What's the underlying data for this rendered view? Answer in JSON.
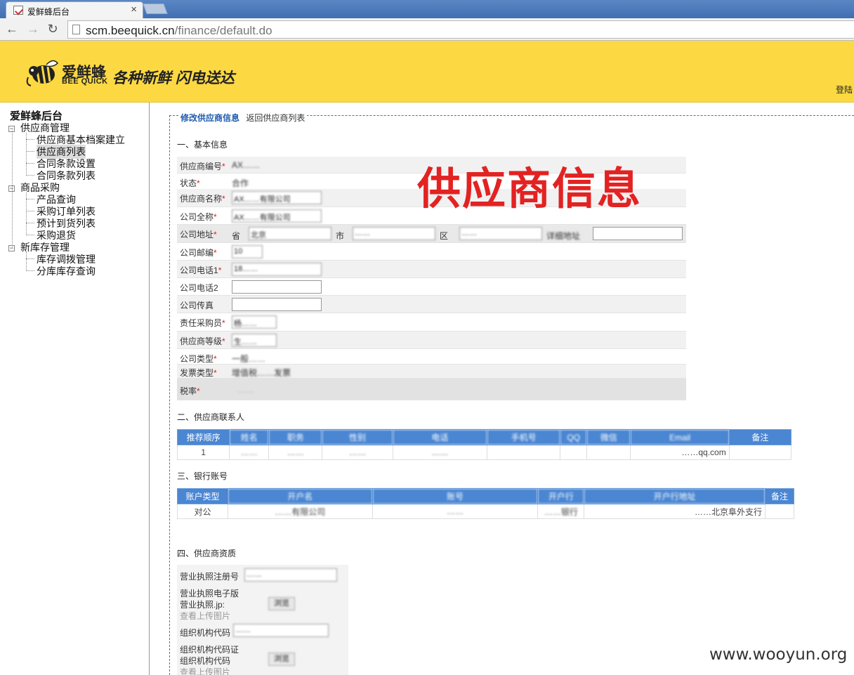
{
  "browser": {
    "tab_title": "爱鲜蜂后台",
    "close_glyph": "×",
    "url_host": "scm.beequick.cn",
    "url_path": "/finance/default.do",
    "back_glyph": "←",
    "forward_glyph": "→",
    "reload_glyph": "↻"
  },
  "header": {
    "logo_name": "爱鲜蜂",
    "logo_en": "BEE QUICK",
    "slogan": "各种新鲜  闪电送达",
    "login": "登陆",
    "bg_color": "#fcd943"
  },
  "sidebar": {
    "title": "爱鲜蜂后台",
    "groups": [
      {
        "label": "供应商管理",
        "expand": "−",
        "items": [
          "供应商基本档案建立",
          "供应商列表",
          "合同条款设置",
          "合同条款列表"
        ]
      },
      {
        "label": "商品采购",
        "expand": "−",
        "items": [
          "产品查询",
          "采购订单列表",
          "预计到货列表",
          "采购退货"
        ]
      },
      {
        "label": "新库存管理",
        "expand": "−",
        "items": [
          "库存调拨管理",
          "分库库存查询"
        ]
      }
    ],
    "active_item": "供应商列表"
  },
  "content": {
    "breadcrumb_current": "修改供应商信息",
    "breadcrumb_back": "返回供应商列表",
    "overlay_title": "供应商信息",
    "section1": "一、基本信息",
    "fields": [
      {
        "label": "供应商编号",
        "required": "*",
        "value": "AX……"
      },
      {
        "label": "状态",
        "required": "*",
        "value": "合作"
      },
      {
        "label": "供应商名称",
        "required": "*",
        "value": "AX……有限公司"
      },
      {
        "label": "公司全称",
        "required": "*",
        "value": "AX……有限公司"
      },
      {
        "label": "公司地址",
        "required": "*",
        "value": ""
      },
      {
        "label": "公司邮编",
        "required": "*",
        "value": "10"
      },
      {
        "label": "公司电话1",
        "required": "*",
        "value": "18……"
      },
      {
        "label": "公司电话2",
        "required": "",
        "value": ""
      },
      {
        "label": "公司传真",
        "required": "",
        "value": ""
      },
      {
        "label": "责任采购员",
        "required": "*",
        "value": "杨……"
      },
      {
        "label": "供应商等级",
        "required": "*",
        "value": "生……"
      },
      {
        "label": "公司类型",
        "required": "*",
        "value": "一般……"
      },
      {
        "label": "发票类型",
        "required": "*",
        "value": "增值税……发票"
      },
      {
        "label": "税率",
        "required": "*",
        "value": "……"
      }
    ],
    "address": {
      "province_label": "省",
      "city_label": "市",
      "district_label": "区",
      "detail_label": "详细地址",
      "province": "北京",
      "city": "……",
      "district": "……"
    },
    "section2": "二、供应商联系人",
    "contact_headers": [
      "推荐顺序",
      "姓名",
      "职务",
      "性别",
      "电话",
      "手机号",
      "QQ",
      "微信",
      "Email",
      "备注"
    ],
    "contact_row": [
      "1",
      "……",
      "……",
      "……",
      "……",
      "",
      "",
      "",
      "……qq.com",
      ""
    ],
    "section3": "三、银行账号",
    "bank_headers": [
      "账户类型",
      "开户名",
      "账号",
      "开户行",
      "开户行地址",
      "备注"
    ],
    "bank_row": [
      "对公",
      "……有限公司",
      "……",
      "……银行",
      "……北京阜外支行",
      ""
    ],
    "section4": "四、供应商资质",
    "license_no_label": "营业执照注册号",
    "license_no_value": "……",
    "license_file_label": "营业执照电子版",
    "license_file_name": "营业执照.jp:",
    "license_file_button": "浏览",
    "view_upload": "查看上传图片",
    "org_code_label": "组织机构代码",
    "org_code_value": "……",
    "org_file_label": "组织机构代码证",
    "org_file_name": "组织机构代码",
    "org_file_button": "浏览",
    "view_upload2": "查看上传图片"
  },
  "footer_watermark": "www.wooyun.org"
}
